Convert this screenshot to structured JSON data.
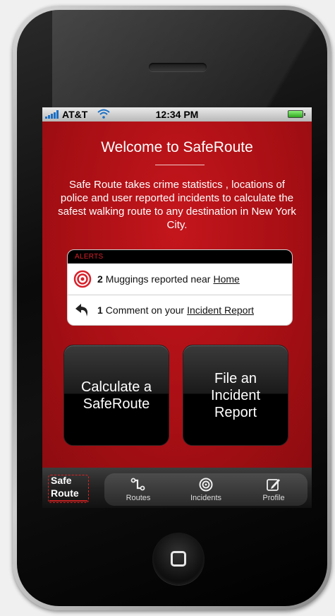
{
  "status_bar": {
    "carrier": "AT&T",
    "time": "12:34 PM"
  },
  "main": {
    "title": "Welcome to SafeRoute",
    "description": "Safe Route takes crime statistics , locations of police and user reported incidents to calculate the safest walking route to any destination in New York City."
  },
  "alerts": {
    "header": "ALERTS",
    "items": [
      {
        "count": "2",
        "text": "Muggings reported near",
        "link": "Home",
        "icon": "target-icon"
      },
      {
        "count": "1",
        "text": "Comment on your",
        "link": "Incident Report",
        "icon": "reply-arrow-icon"
      }
    ]
  },
  "buttons": {
    "calculate": "Calculate a\nSafeRoute",
    "file": "File an\nIncident\nReport"
  },
  "tab_bar": {
    "logo_line1": "Safe",
    "logo_line2": "Route",
    "tabs": [
      {
        "label": "Routes",
        "icon": "route-icon"
      },
      {
        "label": "Incidents",
        "icon": "target-icon"
      },
      {
        "label": "Profile",
        "icon": "edit-icon"
      }
    ]
  },
  "colors": {
    "accent_red": "#c4161c",
    "battery_green": "#2ea51f"
  }
}
